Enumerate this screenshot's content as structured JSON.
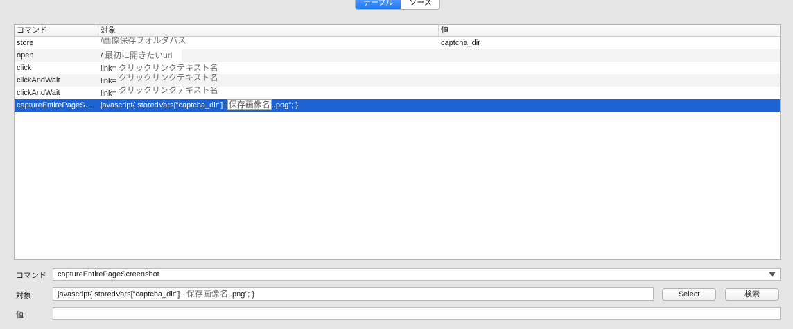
{
  "tabs": [
    {
      "label": "テーブル",
      "active": true
    },
    {
      "label": "ソース",
      "active": false
    }
  ],
  "table": {
    "columns": [
      "コマンド",
      "対象",
      "値"
    ],
    "rows": [
      {
        "command": "store",
        "target_prefix": "",
        "target_placeholder": "/画像保存フォルダパス",
        "value": "captcha_dir"
      },
      {
        "command": "open",
        "target_prefix": "/",
        "target_placeholder": "最初に開きたいurl",
        "value": ""
      },
      {
        "command": "click",
        "target_prefix": "link=",
        "target_placeholder": "クリックリンクテキスト名",
        "value": ""
      },
      {
        "command": "clickAndWait",
        "target_prefix": "link=",
        "target_placeholder": "クリックリンクテキスト名",
        "value": ""
      },
      {
        "command": "clickAndWait",
        "target_prefix": "link=",
        "target_placeholder": "クリックリンクテキスト名",
        "value": ""
      },
      {
        "command": "captureEntirePageS…",
        "target_prefix": "javascript{ storedVars[\"captcha_dir\"]+",
        "target_placeholder": "保存画像名",
        "target_suffix": "..png\"; }",
        "value": ""
      }
    ]
  },
  "form": {
    "command_label": "コマンド",
    "command_value": "captureEntirePageScreenshot",
    "target_label": "対象",
    "target_prefix": "javascript{ storedVars[\"captcha_dir\"]+ ",
    "target_placeholder": "保存画像名",
    "target_suffix": ",.png\"; }",
    "value_label": "値",
    "value_value": "",
    "select_button": "Select",
    "search_button": "検索"
  },
  "colors": {
    "accent": "#1e7bf6",
    "selection": "#1c62d2"
  }
}
